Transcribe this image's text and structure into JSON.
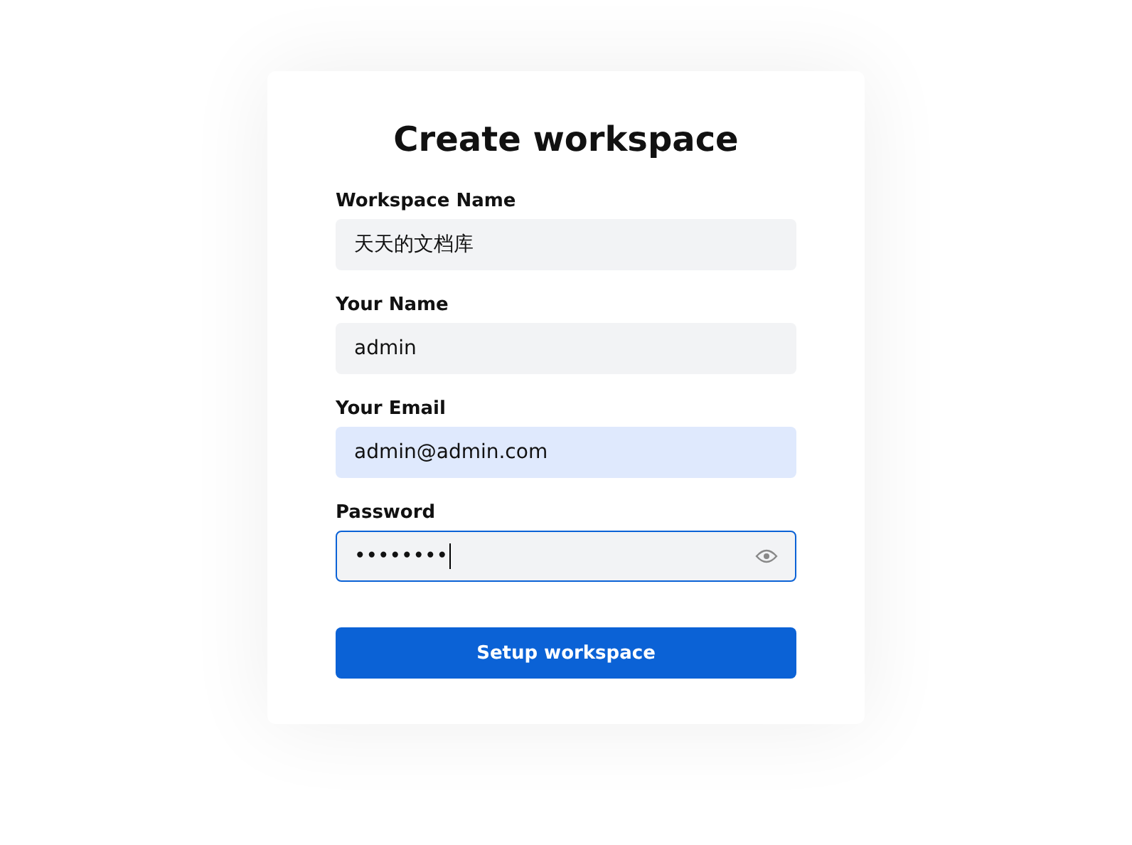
{
  "title": "Create workspace",
  "fields": [
    {
      "label": "Workspace Name",
      "value": "天天的文档库",
      "kind": "text",
      "highlighted": false,
      "focused": false
    },
    {
      "label": "Your Name",
      "value": "admin",
      "kind": "text",
      "highlighted": false,
      "focused": false
    },
    {
      "label": "Your Email",
      "value": "admin@admin.com",
      "kind": "text",
      "highlighted": true,
      "focused": false
    },
    {
      "label": "Password",
      "value": "••••••••",
      "kind": "password",
      "highlighted": false,
      "focused": true
    }
  ],
  "button": "Setup workspace"
}
